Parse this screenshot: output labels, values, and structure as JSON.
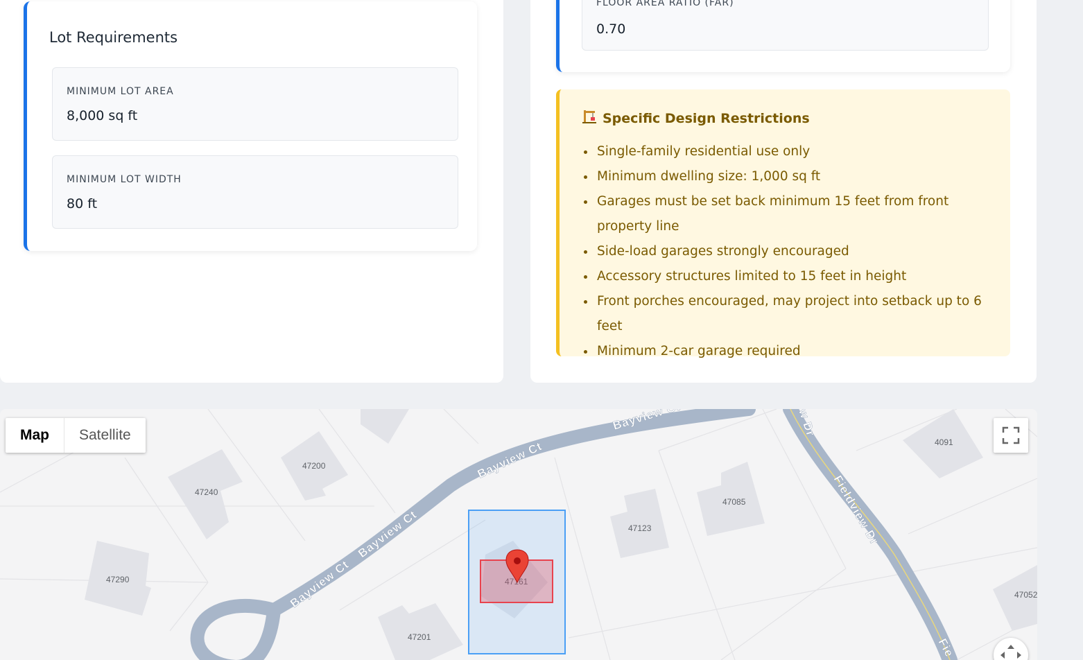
{
  "lot": {
    "title": "Lot Requirements",
    "min_area_label": "MINIMUM LOT AREA",
    "min_area_value": "8,000 sq ft",
    "min_width_label": "MINIMUM LOT WIDTH",
    "min_width_value": "80 ft"
  },
  "far": {
    "label": "FLOOR AREA RATIO (FAR)",
    "value": "0.70"
  },
  "restrictions": {
    "icon": "construction-crane-icon",
    "title": "Specific Design Restrictions",
    "items": [
      "Single-family residential use only",
      "Minimum dwelling size: 1,000 sq ft",
      "Garages must be set back minimum 15 feet from front property line",
      "Side-load garages strongly encouraged",
      "Accessory structures limited to 15 feet in height",
      "Front porches encouraged, may project into setback up to 6 feet",
      "Minimum 2-car garage required"
    ],
    "accent_color": "#f4c021",
    "text_color": "#7a5a00"
  },
  "map": {
    "type_buttons": [
      "Map",
      "Satellite"
    ],
    "active_type": "Map",
    "streets": {
      "bayview_1": "Bayview Ct",
      "bayview_2": "Bayview Ct",
      "bayview_3": "Bayview Ct",
      "bayview_4": "Bayview Ct",
      "fieldview_1": "w Dr",
      "fieldview_2": "Fieldview Dr",
      "fieldview_3": "Fie"
    },
    "house_numbers": {
      "h47240": "47240",
      "h47200": "47200",
      "h47290": "47290",
      "h47201": "47201",
      "h47161": "47161",
      "h47123": "47123",
      "h47085": "47085",
      "h4091": "4091",
      "h47052": "47052"
    },
    "parcel_color": "#4a9ff5",
    "building_color": "#e8434e",
    "marker_color": "#ea4335"
  }
}
